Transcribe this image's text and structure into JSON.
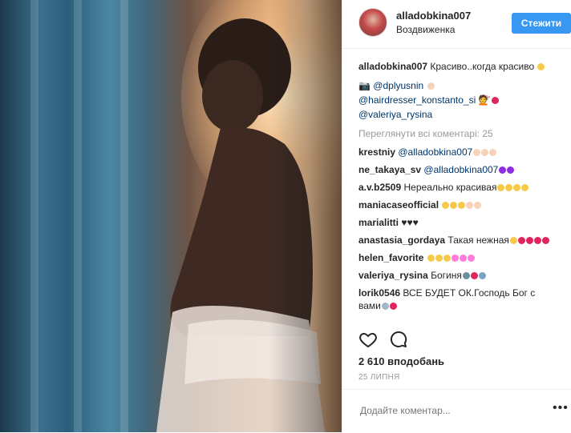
{
  "post": {
    "username": "alladobkina007",
    "location": "Воздвиженка",
    "follow_label": "Стежити",
    "caption_text": "Красиво..когда красиво",
    "credits": {
      "photographer": "@dplyusnin",
      "hairdresser": "@hairdresser_konstanto_si",
      "makeup": "@valeriya_rysina"
    },
    "view_all": "Переглянути всі коментарі: 25"
  },
  "comments": [
    {
      "user": "krestniy",
      "text": "@alladobkina007",
      "emoji": [
        "#f5d2b8",
        "#f5d2b8",
        "#f5d2b8"
      ]
    },
    {
      "user": "ne_takaya_sv",
      "text": "@alladobkina007",
      "emoji": [
        "#8e2de2",
        "#8e2de2"
      ]
    },
    {
      "user": "a.v.b2509",
      "text": "Нереально красивая",
      "emoji": [
        "#f7c948",
        "#f7c948",
        "#f7c948",
        "#f7c948"
      ]
    },
    {
      "user": "maniacaseofficial",
      "text": "",
      "emoji": [
        "#f7c948",
        "#f7c948",
        "#f7c948",
        "#f5d2b8",
        "#f5d2b8"
      ]
    },
    {
      "user": "marialitti",
      "text": "♥♥♥",
      "emoji": []
    },
    {
      "user": "anastasia_gordaya",
      "text": "Такая нежная",
      "emoji": [
        "#f7c948",
        "#e0245e",
        "#e0245e",
        "#e0245e",
        "#e0245e"
      ]
    },
    {
      "user": "helen_favorite",
      "text": "",
      "emoji": [
        "#f7c948",
        "#f7c948",
        "#f7c948",
        "#ff7ad9",
        "#ff7ad9",
        "#ff7ad9"
      ]
    },
    {
      "user": "valeriya_rysina",
      "text": "Богиня",
      "emoji": [
        "#6b8fa3",
        "#e0245e",
        "#7aa2c8"
      ]
    },
    {
      "user": "lorik0546",
      "text": "ВСЕ БУДЕТ ОК.Господь Бог с вами",
      "emoji": [
        "#9fb7c9",
        "#e0245e"
      ]
    }
  ],
  "actions": {
    "likes": "2 610 вподобань",
    "date": "25 липня"
  },
  "add_comment": {
    "placeholder": "Додайте коментар..."
  },
  "colors": {
    "accent": "#3897f0",
    "link": "#003569",
    "muted": "#999999",
    "text": "#262626"
  },
  "icons": [
    "heart-icon",
    "comment-icon",
    "more-options-icon",
    "camera-icon",
    "hairdresser-icon",
    "makeup-icon"
  ]
}
